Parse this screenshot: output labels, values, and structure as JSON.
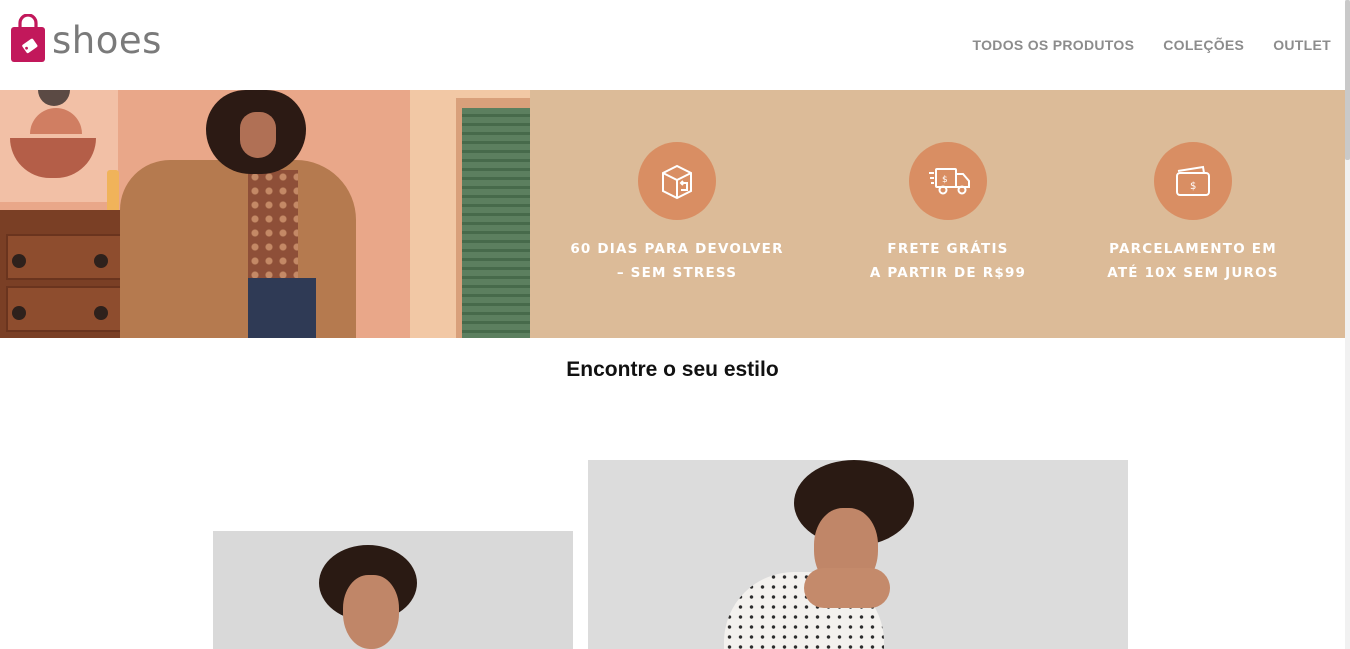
{
  "brand": {
    "name": "shoes",
    "color": "#c2185b"
  },
  "nav": {
    "items": [
      "TODOS OS PRODUTOS",
      "COLEÇÕES",
      "OUTLET"
    ]
  },
  "banner": {
    "background": "#dcbb98",
    "features": [
      {
        "icon": "box-return-icon",
        "line1": "60 DIAS PARA DEVOLVER",
        "line2": "–  SEM STRESS"
      },
      {
        "icon": "delivery-truck-icon",
        "line1": "FRETE GRÁTIS",
        "line2": "A PARTIR DE R$99"
      },
      {
        "icon": "card-payment-icon",
        "line1": "PARCELAMENTO EM",
        "line2": "ATÉ 10X SEM JUROS"
      }
    ]
  },
  "section": {
    "title": "Encontre o seu estilo"
  }
}
